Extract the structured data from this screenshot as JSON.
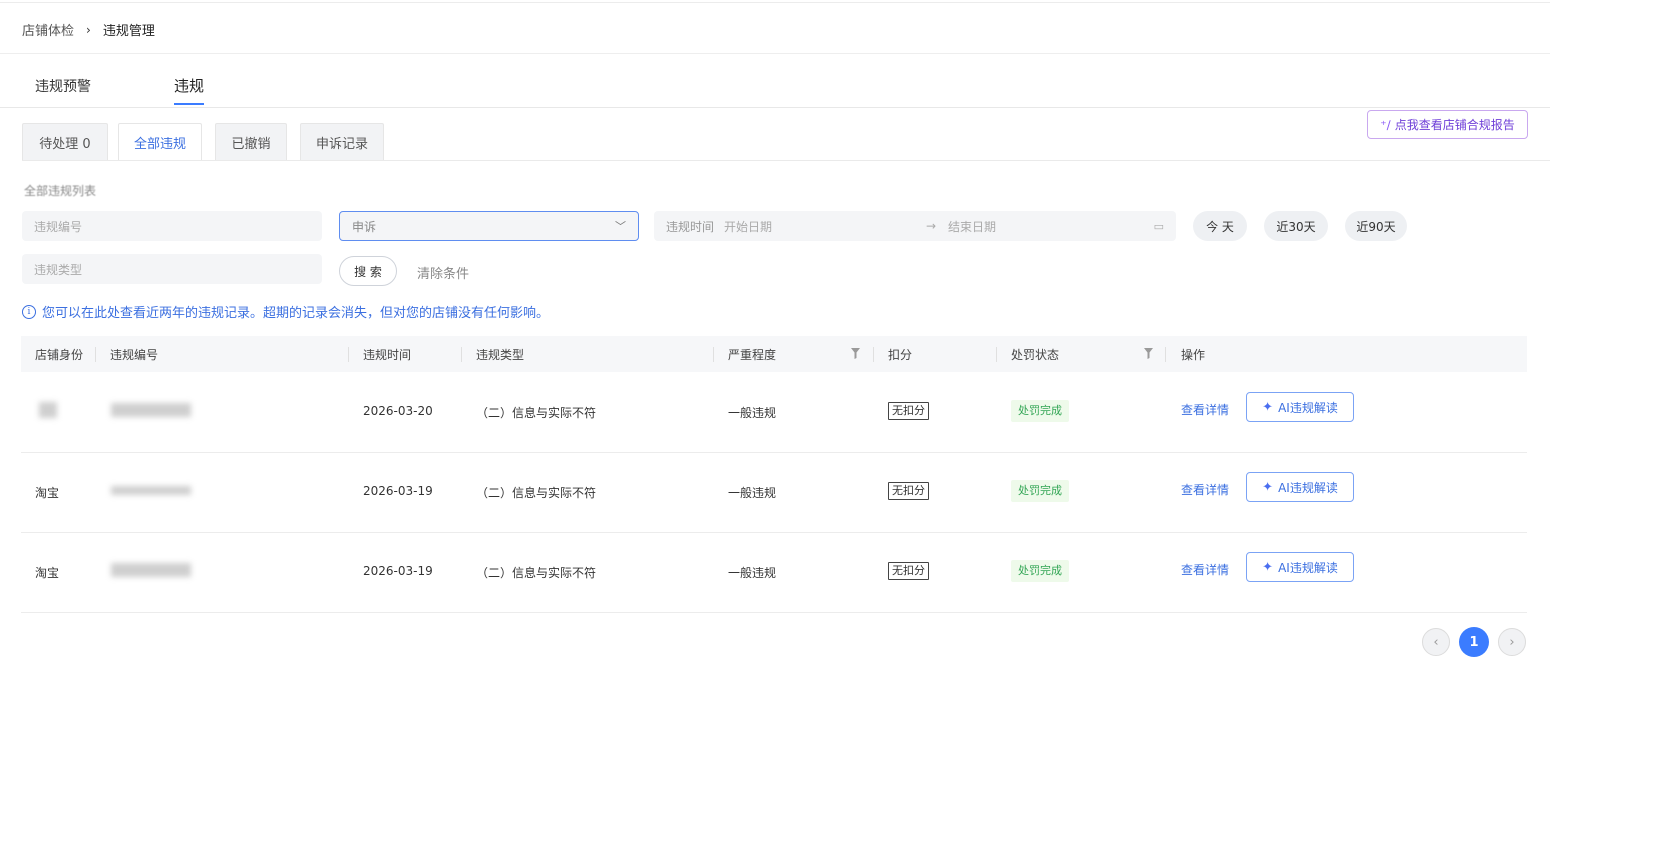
{
  "breadcrumb": {
    "parent": "店铺体检",
    "current": "违规管理"
  },
  "main_tabs": [
    {
      "label": "违规预警"
    },
    {
      "label": "违规"
    }
  ],
  "ai_report_button": "点我查看店铺合规报告",
  "sub_tabs": [
    {
      "label": "待处理 0"
    },
    {
      "label": "全部违规"
    },
    {
      "label": "已撤销"
    },
    {
      "label": "申诉记录"
    }
  ],
  "section_title": "全部违规列表",
  "filters": {
    "violation_id_placeholder": "违规编号",
    "appeal_select_value": "申诉",
    "date_label": "违规时间",
    "start_placeholder": "开始日期",
    "end_placeholder": "结束日期",
    "violation_type_placeholder": "违规类型",
    "quick_ranges": [
      "今 天",
      "近30天",
      "近90天"
    ],
    "search_button": "搜 索",
    "clear_button": "清除条件"
  },
  "notice": "您可以在此处查看近两年的违规记录。超期的记录会消失，但对您的店铺没有任何影响。",
  "table": {
    "columns": [
      "店铺身份",
      "违规编号",
      "违规时间",
      "违规类型",
      "严重程度",
      "扣分",
      "处罚状态",
      "操作"
    ],
    "rows": [
      {
        "shop": "",
        "date": "2026-03-20",
        "type": "（二）信息与实际不符",
        "severity": "一般违规",
        "deduct": "无扣分",
        "status": "处罚完成",
        "detail": "查看详情",
        "ai": "AI违规解读"
      },
      {
        "shop": "淘宝",
        "date": "2026-03-19",
        "type": "（二）信息与实际不符",
        "severity": "一般违规",
        "deduct": "无扣分",
        "status": "处罚完成",
        "detail": "查看详情",
        "ai": "AI违规解读"
      },
      {
        "shop": "淘宝",
        "date": "2026-03-19",
        "type": "（二）信息与实际不符",
        "severity": "一般违规",
        "deduct": "无扣分",
        "status": "处罚完成",
        "detail": "查看详情",
        "ai": "AI违规解读"
      }
    ]
  },
  "pagination": {
    "current": "1"
  }
}
